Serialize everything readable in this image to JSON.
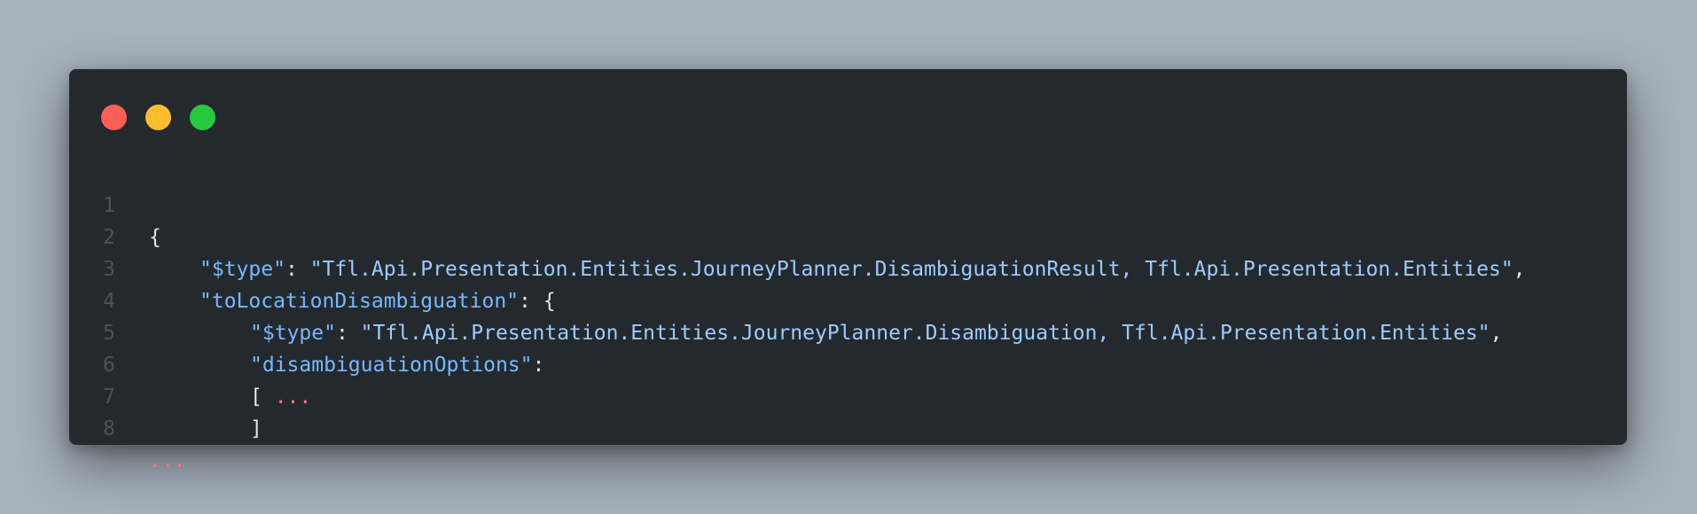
{
  "window": {
    "controls": {
      "close_color": "#ff5f56",
      "minimize_color": "#ffbd2e",
      "maximize_color": "#27c93f"
    }
  },
  "code": {
    "lines": [
      {
        "number": "1",
        "open": "{"
      },
      {
        "number": "2",
        "key": "\"$type\"",
        "colon": ": ",
        "value": "\"Tfl.Api.Presentation.Entities.JourneyPlanner.DisambiguationResult, Tfl.Api.Presentation.Entities\"",
        "trail": ","
      },
      {
        "number": "3",
        "key": "\"toLocationDisambiguation\"",
        "colon": ": ",
        "open": "{"
      },
      {
        "number": "4",
        "key": "\"$type\"",
        "colon": ": ",
        "value": "\"Tfl.Api.Presentation.Entities.JourneyPlanner.Disambiguation, Tfl.Api.Presentation.Entities\"",
        "trail": ","
      },
      {
        "number": "5",
        "key": "\"disambiguationOptions\"",
        "colon": ":"
      },
      {
        "number": "6",
        "open": "[ ",
        "ellipsis": "..."
      },
      {
        "number": "7",
        "close": "]"
      },
      {
        "number": "8",
        "ellipsis": "..."
      }
    ]
  }
}
